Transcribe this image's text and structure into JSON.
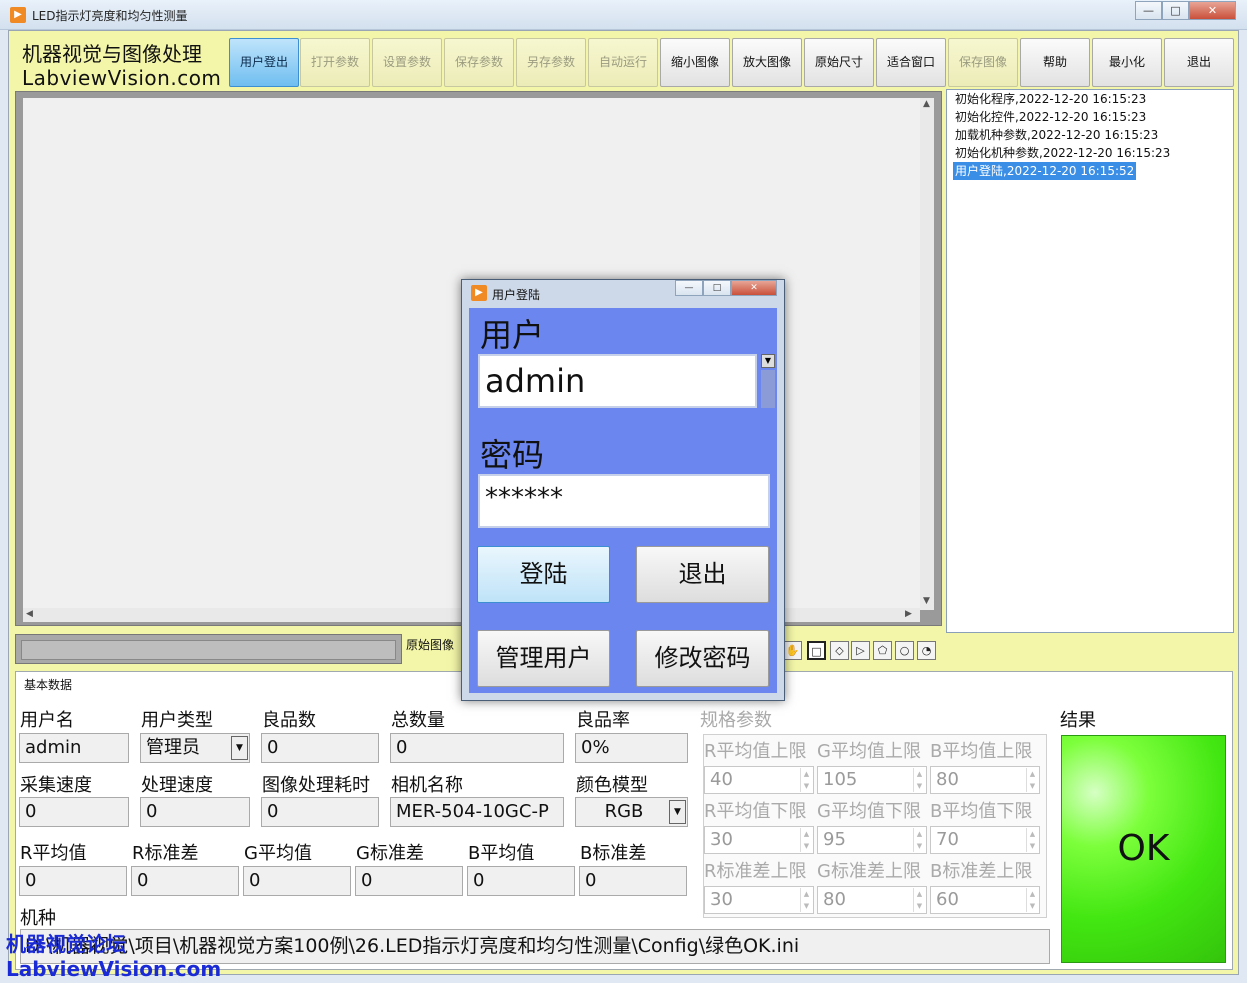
{
  "window": {
    "title": "LED指示灯亮度和均匀性测量",
    "controls": {
      "minimize": "—",
      "maximize": "□",
      "close": "✕"
    }
  },
  "brand": {
    "line1": "机器视觉与图像处理",
    "line2": "LabviewVision.com"
  },
  "toolbar": [
    {
      "label": "用户登出",
      "state": "active"
    },
    {
      "label": "打开参数",
      "state": "disabled"
    },
    {
      "label": "设置参数",
      "state": "disabled"
    },
    {
      "label": "保存参数",
      "state": "disabled"
    },
    {
      "label": "另存参数",
      "state": "disabled"
    },
    {
      "label": "自动运行",
      "state": "disabled"
    },
    {
      "label": "缩小图像",
      "state": "enabled"
    },
    {
      "label": "放大图像",
      "state": "enabled"
    },
    {
      "label": "原始尺寸",
      "state": "enabled"
    },
    {
      "label": "适合窗口",
      "state": "enabled"
    },
    {
      "label": "保存图像",
      "state": "disabled"
    },
    {
      "label": "帮助",
      "state": "enabled"
    },
    {
      "label": "最小化",
      "state": "enabled"
    },
    {
      "label": "退出",
      "state": "enabled"
    }
  ],
  "image_view": {
    "caption": "原始图像"
  },
  "log": [
    {
      "text": "初始化程序,2022-12-20 16:15:23",
      "selected": false
    },
    {
      "text": "初始化控件,2022-12-20 16:15:23",
      "selected": false
    },
    {
      "text": "加载机种参数,2022-12-20 16:15:23",
      "selected": false
    },
    {
      "text": "初始化机种参数,2022-12-20 16:15:23",
      "selected": false
    },
    {
      "text": "用户登陆,2022-12-20 16:15:52",
      "selected": true
    }
  ],
  "panel": {
    "title": "基本数据",
    "row1": {
      "username_label": "用户名",
      "username": "admin",
      "usertype_label": "用户类型",
      "usertype": "管理员",
      "good_label": "良品数",
      "good": "0",
      "total_label": "总数量",
      "total": "0",
      "yield_label": "良品率",
      "yield": "0%"
    },
    "row2": {
      "capture_label": "采集速度",
      "capture": "0",
      "process_label": "处理速度",
      "process": "0",
      "time_label": "图像处理耗时",
      "time": "0",
      "camera_label": "相机名称",
      "camera": "MER-504-10GC-P",
      "color_label": "颜色模型",
      "color": "RGB"
    },
    "row3": {
      "r_mean_label": "R平均值",
      "r_mean": "0",
      "r_std_label": "R标准差",
      "r_std": "0",
      "g_mean_label": "G平均值",
      "g_mean": "0",
      "g_std_label": "G标准差",
      "g_std": "0",
      "b_mean_label": "B平均值",
      "b_mean": "0",
      "b_std_label": "B标准差",
      "b_std": "0"
    },
    "model_label": "机种",
    "model_path": "D:\\机器视觉\\项目\\机器视觉方案100例\\26.LED指示灯亮度和均匀性测量\\Config\\绿色OK.ini",
    "spec": {
      "title": "规格参数",
      "rows": [
        {
          "labels": [
            "R平均值上限",
            "G平均值上限",
            "B平均值上限"
          ],
          "values": [
            "40",
            "105",
            "80"
          ]
        },
        {
          "labels": [
            "R平均值下限",
            "G平均值下限",
            "B平均值下限"
          ],
          "values": [
            "30",
            "95",
            "70"
          ]
        },
        {
          "labels": [
            "R标准差上限",
            "G标准差上限",
            "B标准差上限"
          ],
          "values": [
            "30",
            "80",
            "60"
          ]
        }
      ]
    },
    "result_label": "结果",
    "result": "OK"
  },
  "login_dialog": {
    "title": "用户登陆",
    "user_label": "用户",
    "user_value": "admin",
    "password_label": "密码",
    "password_value": "******",
    "login_button": "登陆",
    "exit_button": "退出",
    "manage_button": "管理用户",
    "change_pw_button": "修改密码"
  },
  "watermark": {
    "line1": "机器视觉论坛",
    "line2": "LabviewVision.com"
  }
}
